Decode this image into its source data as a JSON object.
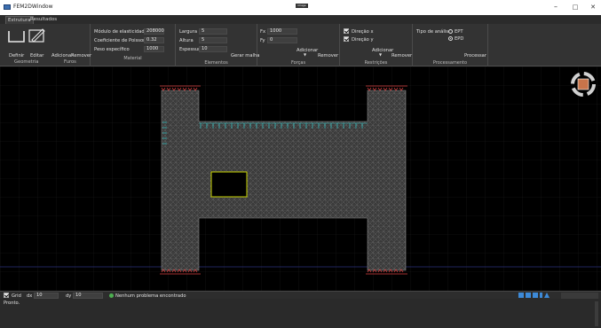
{
  "window": {
    "title": "FEM2DWindow",
    "center_tag": "image",
    "min": "–",
    "max": "□",
    "close": "✕"
  },
  "tabs": [
    "Estrutura",
    "Resultados"
  ],
  "ribbon": {
    "geometria": {
      "buttons": [
        "Definir",
        "Editar",
        "Adicionar",
        "Remover"
      ],
      "label": "Geometria",
      "furos_label": "Furos"
    },
    "material": {
      "label": "Material",
      "fields": [
        {
          "label": "Módulo de elasticidade",
          "value": "208000"
        },
        {
          "label": "Coeficiente de Poisson",
          "value": "0.32"
        },
        {
          "label": "Peso específico",
          "value": "1000"
        }
      ]
    },
    "elementos": {
      "label": "Elementos",
      "fields": [
        {
          "label": "Largura",
          "value": "5"
        },
        {
          "label": "Altura",
          "value": "5"
        },
        {
          "label": "Espessura",
          "value": "10"
        }
      ],
      "mesh_button": "Gerar malha"
    },
    "forcas": {
      "label": "Forças",
      "fields": [
        {
          "label": "Fx",
          "value": "1000"
        },
        {
          "label": "Fy",
          "value": "0"
        }
      ],
      "add": "Adicionar",
      "remove": "Remover"
    },
    "restricoes": {
      "label": "Restrições",
      "checks": [
        "Direção x",
        "Direção y"
      ],
      "add": "Adicionar",
      "remove": "Remover"
    },
    "processamento": {
      "label": "Processamento",
      "analysis_label": "Tipo de análise",
      "options": [
        "EPT",
        "EPD"
      ],
      "selected": "EPD",
      "process": "Processar"
    }
  },
  "status": {
    "grid_label": "Grid",
    "dx_label": "dx",
    "dx": "10",
    "dy_label": "dy",
    "dy": "10",
    "message": "Nenhum problema encontrado",
    "ok_color": "#4caf50"
  },
  "console": {
    "text": "Pronto."
  },
  "colors": {
    "mesh": "#6a6a6a",
    "support": "#d94040",
    "force": "#37c3c3",
    "hole_border": "#c8d400"
  }
}
